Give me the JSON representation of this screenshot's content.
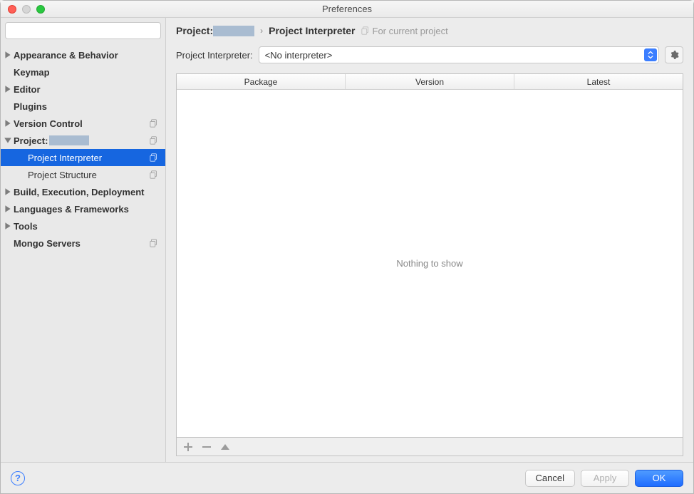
{
  "window": {
    "title": "Preferences"
  },
  "search": {
    "placeholder": ""
  },
  "sidebar": {
    "items": [
      {
        "label": "Appearance & Behavior"
      },
      {
        "label": "Keymap"
      },
      {
        "label": "Editor"
      },
      {
        "label": "Plugins"
      },
      {
        "label": "Version Control"
      },
      {
        "label": "Project:"
      },
      {
        "label": "Project Interpreter"
      },
      {
        "label": "Project Structure"
      },
      {
        "label": "Build, Execution, Deployment"
      },
      {
        "label": "Languages & Frameworks"
      },
      {
        "label": "Tools"
      },
      {
        "label": "Mongo Servers"
      }
    ]
  },
  "breadcrumb": {
    "project_prefix": "Project:",
    "current": "Project Interpreter",
    "hint": "For current project"
  },
  "interpreter": {
    "label": "Project Interpreter:",
    "value": "<No interpreter>"
  },
  "table": {
    "columns": [
      "Package",
      "Version",
      "Latest"
    ],
    "empty_text": "Nothing to show"
  },
  "footer": {
    "cancel": "Cancel",
    "apply": "Apply",
    "ok": "OK",
    "help": "?"
  }
}
